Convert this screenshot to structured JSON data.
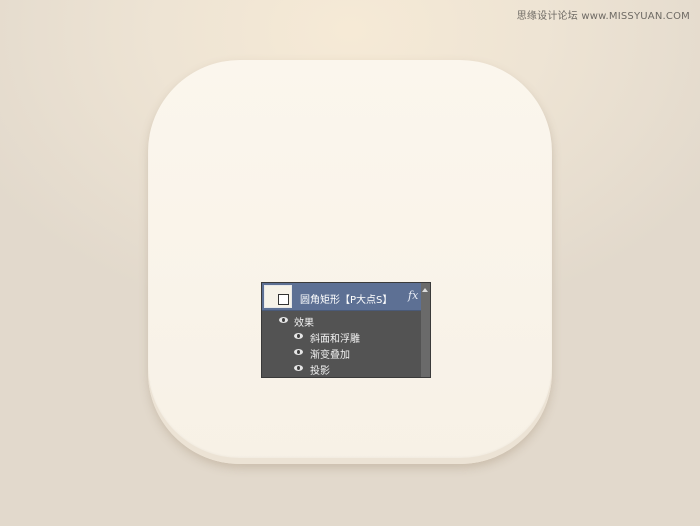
{
  "watermark": "思缘设计论坛 www.MISSYUAN.COM",
  "layers_panel": {
    "layer_name": "圆角矩形【P大点S】",
    "fx_icon": "fx",
    "effects_label": "效果",
    "effects": [
      "斜面和浮雕",
      "渐变叠加",
      "投影"
    ]
  },
  "colors": {
    "background": "#e9e1d4",
    "icon_fill": "#faf5ec",
    "panel_bg": "#535353",
    "selected_layer": "#5d7094"
  }
}
